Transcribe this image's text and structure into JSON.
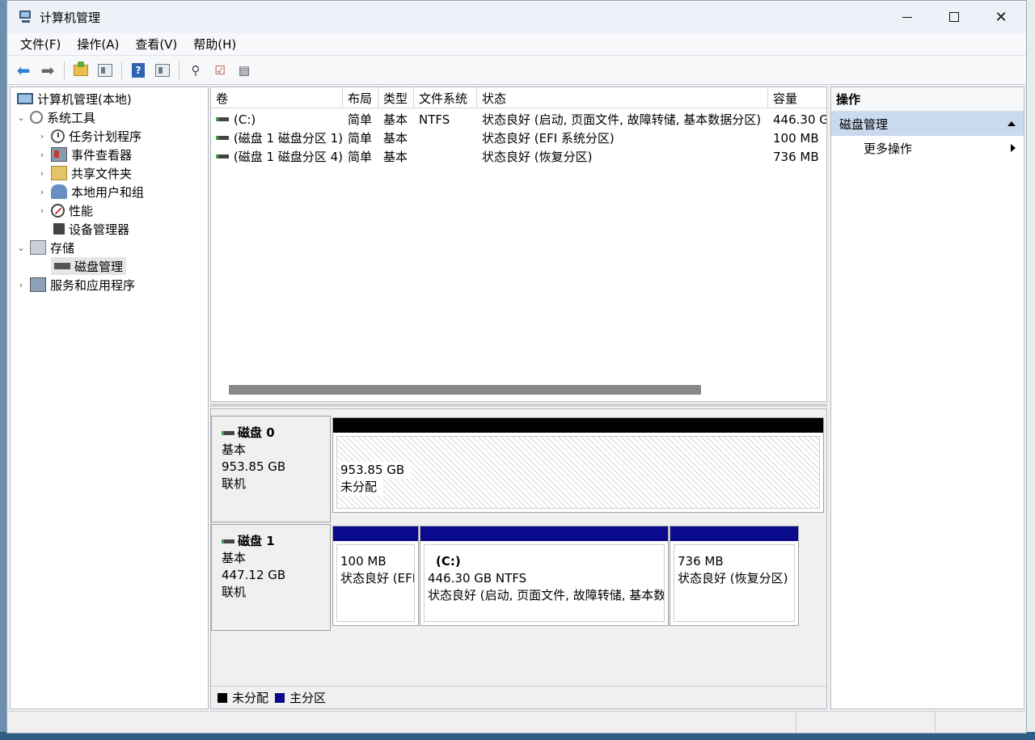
{
  "window": {
    "title": "计算机管理"
  },
  "menu": [
    "文件(F)",
    "操作(A)",
    "查看(V)",
    "帮助(H)"
  ],
  "toolbar": {
    "back_icon": "back-arrow-icon",
    "forward_icon": "forward-arrow-icon",
    "help_glyph": "?"
  },
  "tree": {
    "root": "计算机管理(本地)",
    "system_tools": "系统工具",
    "task_scheduler": "任务计划程序",
    "event_viewer": "事件查看器",
    "shared_folders": "共享文件夹",
    "local_users": "本地用户和组",
    "performance": "性能",
    "device_manager": "设备管理器",
    "storage": "存储",
    "disk_management": "磁盘管理",
    "services_apps": "服务和应用程序"
  },
  "volume_list": {
    "columns": [
      "卷",
      "布局",
      "类型",
      "文件系统",
      "状态",
      "容量"
    ],
    "rows": [
      {
        "volume": "(C:)",
        "layout": "简单",
        "type": "基本",
        "fs": "NTFS",
        "status": "状态良好 (启动, 页面文件, 故障转储, 基本数据分区)",
        "capacity": "446.30 G"
      },
      {
        "volume": "(磁盘 1 磁盘分区 1)",
        "layout": "简单",
        "type": "基本",
        "fs": "",
        "status": "状态良好 (EFI 系统分区)",
        "capacity": "100 MB"
      },
      {
        "volume": "(磁盘 1 磁盘分区 4)",
        "layout": "简单",
        "type": "基本",
        "fs": "",
        "status": "状态良好 (恢复分区)",
        "capacity": "736 MB"
      }
    ]
  },
  "disks": [
    {
      "name": "磁盘 0",
      "kind": "基本",
      "size": "953.85 GB",
      "state": "联机",
      "partitions": [
        {
          "title": "",
          "size": "953.85 GB",
          "status": "未分配"
        }
      ]
    },
    {
      "name": "磁盘 1",
      "kind": "基本",
      "size": "447.12 GB",
      "state": "联机",
      "partitions": [
        {
          "title": "",
          "size": "100 MB",
          "status": "状态良好 (EFI"
        },
        {
          "title": "(C:)",
          "size": "446.30 GB NTFS",
          "status": "状态良好 (启动, 页面文件, 故障转储, 基本数"
        },
        {
          "title": "",
          "size": "736 MB",
          "status": "状态良好 (恢复分区)"
        }
      ]
    }
  ],
  "legend": {
    "unallocated": "未分配",
    "primary": "主分区"
  },
  "actions": {
    "title": "操作",
    "section": "磁盘管理",
    "more": "更多操作"
  },
  "colors": {
    "unallocated": "#000000",
    "primary": "#0a0a8c",
    "selected_section": "#c9d9ee"
  }
}
